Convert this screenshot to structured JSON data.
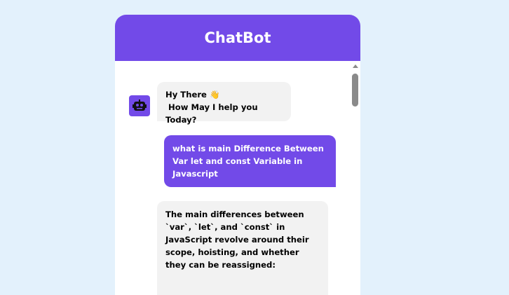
{
  "chatbot": {
    "title": "ChatBot",
    "bot_avatar_icon": "robot-icon",
    "messages": [
      {
        "role": "bot",
        "text": "Hy There 👋\n How May I help you Today?"
      },
      {
        "role": "user",
        "text": "what is main Difference Between Var let and const Variable in Javascript"
      },
      {
        "role": "bot",
        "text": "The main differences between `var`, `let`, and `const` in JavaScript revolve around their scope, hoisting, and whether they can be reassigned:"
      }
    ]
  },
  "colors": {
    "page_background": "#e3f1fc",
    "accent": "#724ae8",
    "bot_bubble": "#f2f2f2",
    "user_text": "#ffffff"
  }
}
